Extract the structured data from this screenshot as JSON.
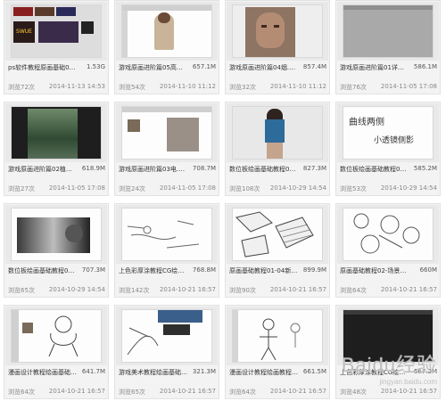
{
  "files": [
    {
      "title": "ps软件教程原画基础01补...",
      "size": "1.53G",
      "views": "浏览72次",
      "date": "2014-11-13 14:53"
    },
    {
      "title": "游戏原画进阶篇05高生生...",
      "size": "657.1M",
      "views": "浏览54次",
      "date": "2014-11-10 11:12"
    },
    {
      "title": "游戏原画进阶篇04烟.mp4",
      "size": "857.4M",
      "views": "浏览32次",
      "date": "2014-11-10 11:12"
    },
    {
      "title": "游戏原画进阶篇01详细的...",
      "size": "586.1M",
      "views": "浏览76次",
      "date": "2014-11-05 17:08"
    },
    {
      "title": "游戏原画进阶篇02植内安...",
      "size": "618.9M",
      "views": "浏览27次",
      "date": "2014-11-05 17:08"
    },
    {
      "title": "游戏原画进阶篇03电.mp4",
      "size": "708.7M",
      "views": "浏览24次",
      "date": "2014-11-05 17:08"
    },
    {
      "title": "数位板绘画基础教程04色...",
      "size": "827.3M",
      "views": "浏览108次",
      "date": "2014-10-29 14:54"
    },
    {
      "title": "数位板绘画基础教程05细...",
      "size": "585.2M",
      "views": "浏览53次",
      "date": "2014-10-29 14:54"
    },
    {
      "title": "数位板绘画基础教程03会...",
      "size": "707.3M",
      "views": "浏览65次",
      "date": "2014-10-29 14:54"
    },
    {
      "title": "上色彩厚涂教程CG绘图教...",
      "size": "768.8M",
      "views": "浏览142次",
      "date": "2014-10-21 16:57"
    },
    {
      "title": "原画基础教程01-04新场景...",
      "size": "899.9M",
      "views": "浏览90次",
      "date": "2014-10-21 16:57"
    },
    {
      "title": "原画基础教程02-场景厚涂...",
      "size": "660M",
      "views": "浏览64次",
      "date": "2014-10-21 16:57"
    },
    {
      "title": "漫画设计教程绘画基础教程...",
      "size": "641.7M",
      "views": "浏览64次",
      "date": "2014-10-21 16:57"
    },
    {
      "title": "游戏美术教程绘画基础教程...",
      "size": "321.3M",
      "views": "浏览65次",
      "date": "2014-10-21 16:57"
    },
    {
      "title": "漫画设计教程绘画教程04-...",
      "size": "661.5M",
      "views": "浏览64次",
      "date": "2014-10-21 16:57"
    },
    {
      "title": "上色彩厚涂教程CG绘画教...",
      "size": "667.2M",
      "views": "浏览48次",
      "date": "2014-10-21 16:57"
    }
  ],
  "thumb_texts": {
    "logo_small": "SWUE",
    "sketch_note_1": "曲线两侧",
    "sketch_note_2": "小透镜侧影"
  },
  "watermark": {
    "brand": "Baidu经验",
    "sub": "jingyan.baidu.com"
  }
}
